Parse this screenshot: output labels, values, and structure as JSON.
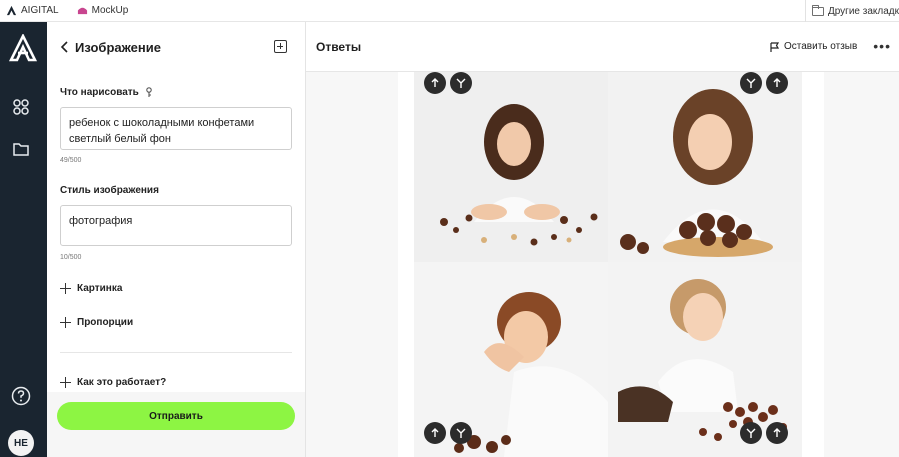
{
  "bookmarks": {
    "items": [
      {
        "label": "AIGITAL",
        "icon": "aigital-logo-icon"
      },
      {
        "label": "MockUp",
        "icon": "mockup-icon"
      }
    ],
    "other_bookmarks": "Другие закладк"
  },
  "rail": {
    "avatar_initials": "НЕ",
    "icons": [
      "app-logo-icon",
      "grid-icon",
      "folder-icon",
      "help-icon"
    ]
  },
  "panel": {
    "title": "Изображение",
    "prompt_label": "Что нарисовать",
    "prompt_value": "ребенок с шоколадными конфетами светлый белый фон",
    "prompt_counter": "49/500",
    "style_label": "Стиль изображения",
    "style_value": "фотография",
    "style_counter": "10/500",
    "expanders": [
      "Картинка",
      "Пропорции",
      "Как это работает?"
    ],
    "submit_label": "Отправить"
  },
  "main": {
    "title": "Ответы",
    "feedback_label": "Оставить отзыв",
    "more_label": "•••"
  },
  "colors": {
    "rail_bg": "#1a2530",
    "submit_bg": "#8df543",
    "action_circle": "#2c2c2c"
  }
}
